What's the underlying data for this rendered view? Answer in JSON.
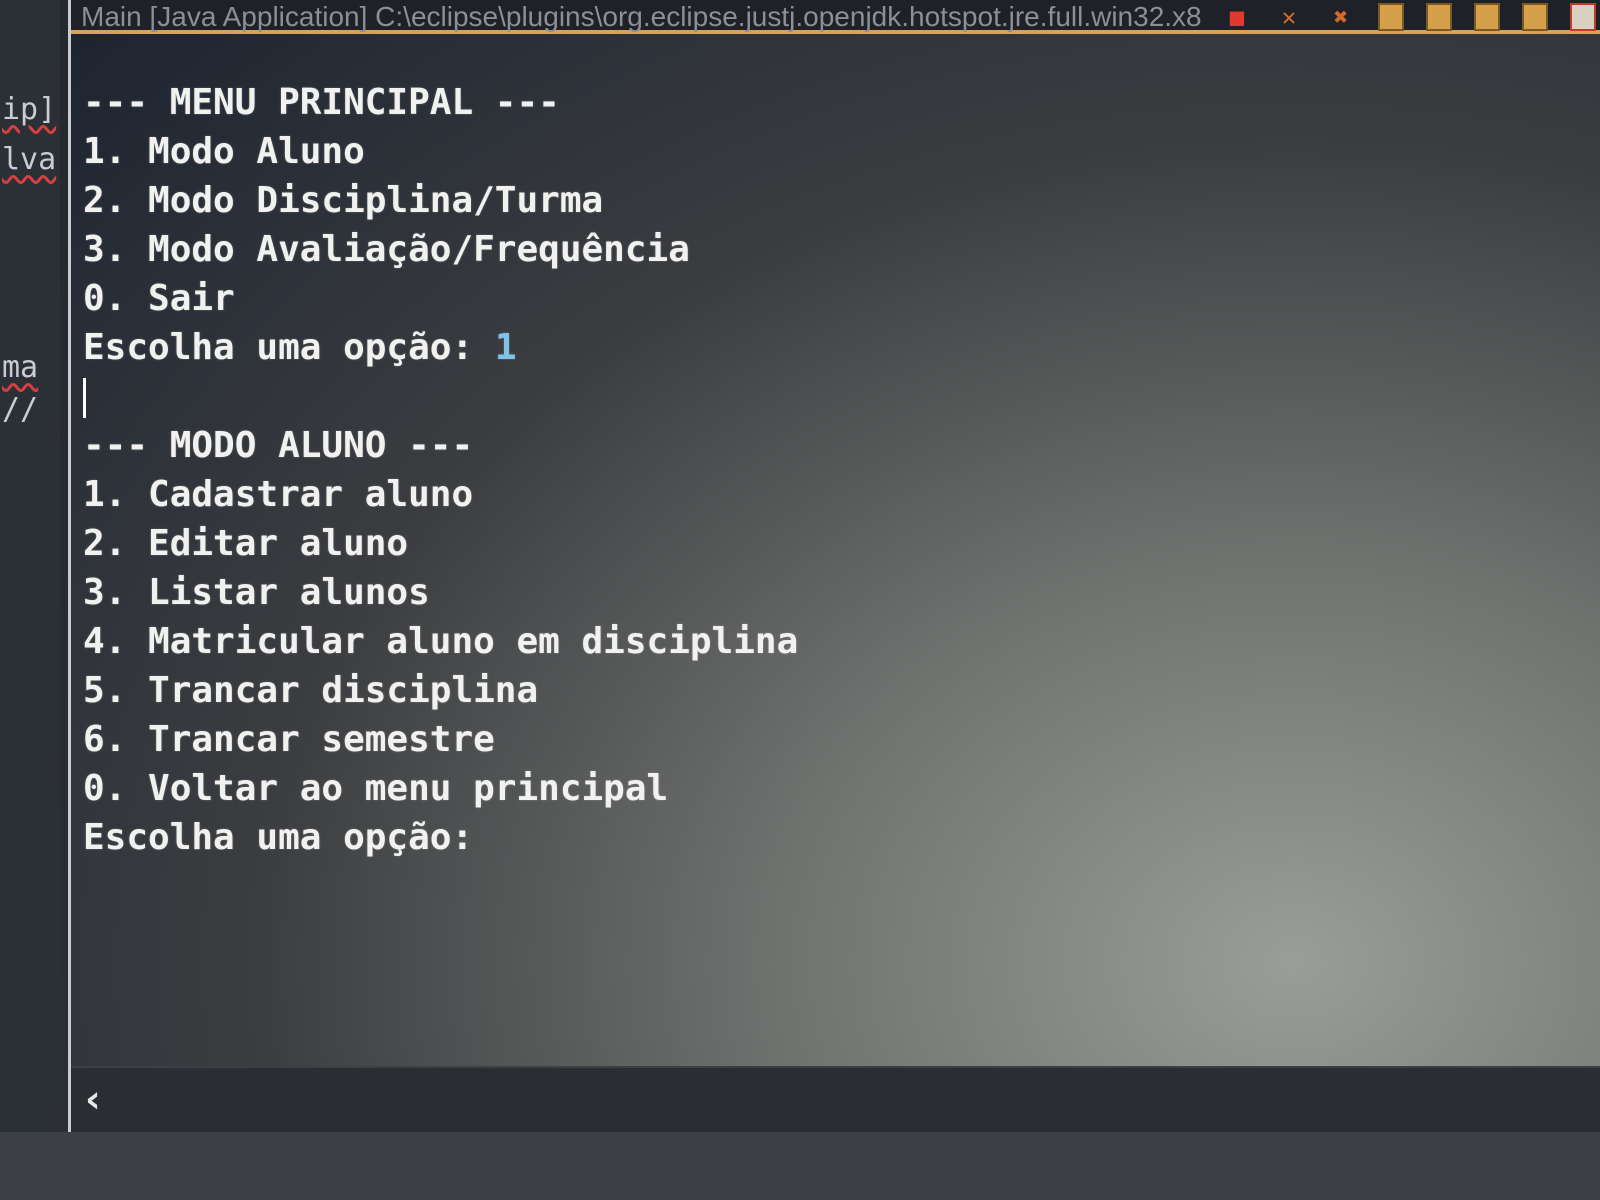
{
  "editor": {
    "fragments": [
      "ip]",
      "lva",
      "ma",
      "//"
    ]
  },
  "console": {
    "title": "Main [Java Application] C:\\eclipse\\plugins\\org.eclipse.justj.openjdk.hotspot.jre.full.win32.x8",
    "toolbar_icons": [
      "stop-icon",
      "remove-launch-icon",
      "remove-all-terminated-icon",
      "clear-console-icon",
      "scroll-lock-icon",
      "word-wrap-icon",
      "show-console-output-icon",
      "show-error-output-icon"
    ],
    "lines": [
      "--- MENU PRINCIPAL ---",
      "1. Modo Aluno",
      "2. Modo Disciplina/Turma",
      "3. Modo Avaliação/Frequência",
      "0. Sair",
      "Escolha uma opção: ",
      "",
      "--- MODO ALUNO ---",
      "1. Cadastrar aluno",
      "2. Editar aluno",
      "3. Listar alunos",
      "4. Matricular aluno em disciplina",
      "5. Trancar disciplina",
      "6. Trancar semestre",
      "0. Voltar ao menu principal",
      "Escolha uma opção: "
    ],
    "user_input": "1"
  },
  "colors": {
    "console_text": "#f1f1ef",
    "input_echo": "#7ec3e8",
    "header_accent": "#d9a25a"
  }
}
